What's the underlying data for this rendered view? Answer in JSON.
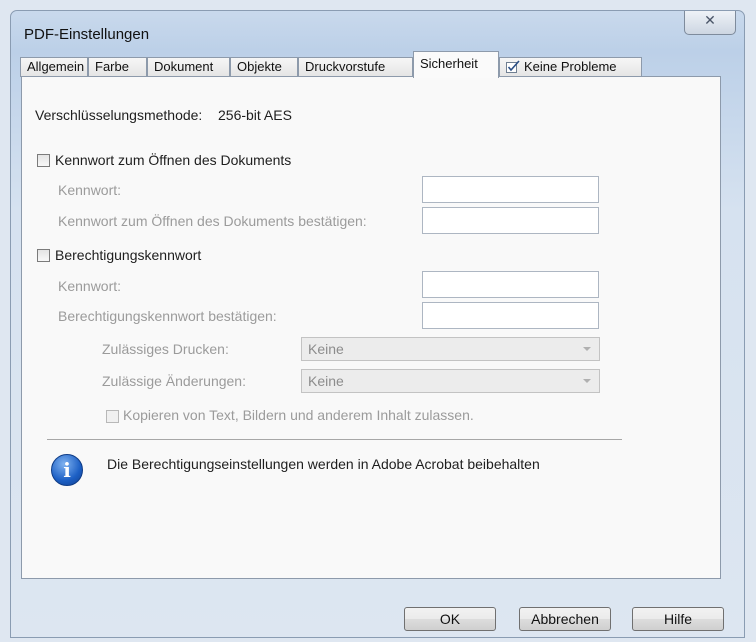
{
  "window": {
    "title": "PDF-Einstellungen",
    "close_glyph": "✕"
  },
  "tabs": [
    {
      "label": "Allgemein"
    },
    {
      "label": "Farbe"
    },
    {
      "label": "Dokument"
    },
    {
      "label": "Objekte"
    },
    {
      "label": "Druckvorstufe"
    },
    {
      "label": "Sicherheit"
    },
    {
      "label": "Keine Probleme"
    }
  ],
  "security": {
    "method_label": "Verschlüsselungsmethode:",
    "method_value": "256-bit AES",
    "open_password": {
      "checkbox_label": "Kennwort zum Öffnen des Dokuments",
      "checked": false,
      "password_label": "Kennwort:",
      "confirm_label": "Kennwort zum Öffnen des Dokuments bestätigen:"
    },
    "permissions": {
      "checkbox_label": "Berechtigungskennwort",
      "checked": false,
      "password_label": "Kennwort:",
      "confirm_label": "Berechtigungskennwort bestätigen:",
      "printing_label": "Zulässiges Drucken:",
      "printing_value": "Keine",
      "changes_label": "Zulässige Änderungen:",
      "changes_value": "Keine",
      "copy_label": "Kopieren von Text, Bildern und anderem Inhalt zulassen.",
      "copy_checked": false
    },
    "info_text": "Die Berechtigungseinstellungen werden in Adobe Acrobat beibehalten"
  },
  "buttons": {
    "ok": "OK",
    "cancel": "Abbrechen",
    "help": "Hilfe"
  },
  "icons": {
    "info": "info-icon",
    "check": "checkmark-icon",
    "close": "close-icon"
  },
  "colors": {
    "active_tab_bg": "#fafafa",
    "info_blue": "#1c5fc4",
    "disabled_text": "#9b9b9b"
  }
}
